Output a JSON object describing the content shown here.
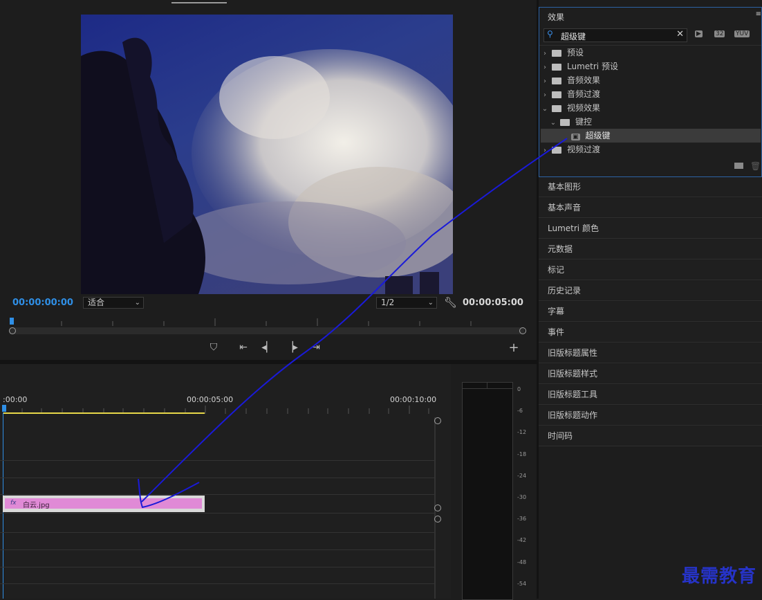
{
  "program_monitor": {
    "current_time": "00:00:00:00",
    "fit_select": "适合",
    "resolution_select": "1/2",
    "duration": "00:00:05:00"
  },
  "timeline": {
    "ruler": [
      ":00:00",
      "00:00:05:00",
      "00:00:10:00"
    ],
    "clip_name": "白云.jpg",
    "fx": "fx"
  },
  "audio_meter": {
    "db_labels": [
      "0",
      "-6",
      "-12",
      "-18",
      "-24",
      "-30",
      "-36",
      "-42",
      "-48",
      "-54"
    ]
  },
  "effects_panel": {
    "title": "效果",
    "search_value": "超级键",
    "toolbar_badges": [
      "32",
      "YUV"
    ],
    "tree": [
      {
        "label": "预设",
        "level": 0,
        "expanded": false,
        "icon": "folder-star-icon"
      },
      {
        "label": "Lumetri 预设",
        "level": 0,
        "expanded": false,
        "icon": "folder-star-icon"
      },
      {
        "label": "音频效果",
        "level": 0,
        "expanded": false,
        "icon": "folder-icon"
      },
      {
        "label": "音频过渡",
        "level": 0,
        "expanded": false,
        "icon": "folder-icon"
      },
      {
        "label": "视频效果",
        "level": 0,
        "expanded": true,
        "icon": "folder-icon"
      },
      {
        "label": "键控",
        "level": 1,
        "expanded": true,
        "icon": "folder-icon"
      },
      {
        "label": "超级键",
        "level": 2,
        "selected": true,
        "icon": "effect-icon"
      },
      {
        "label": "视频过渡",
        "level": 0,
        "expanded": false,
        "icon": "folder-icon"
      }
    ]
  },
  "panels": [
    "基本图形",
    "基本声音",
    "Lumetri 颜色",
    "元数据",
    "标记",
    "历史记录",
    "字幕",
    "事件",
    "旧版标题属性",
    "旧版标题样式",
    "旧版标题工具",
    "旧版标题动作",
    "时间码"
  ],
  "watermark": "最需教育",
  "colors": {
    "accent_blue": "#2f8fe6",
    "clip_pink": "#e08ad6",
    "work_area_yellow": "#e8d84a",
    "annotation_stroke": "#1a1ad8"
  }
}
